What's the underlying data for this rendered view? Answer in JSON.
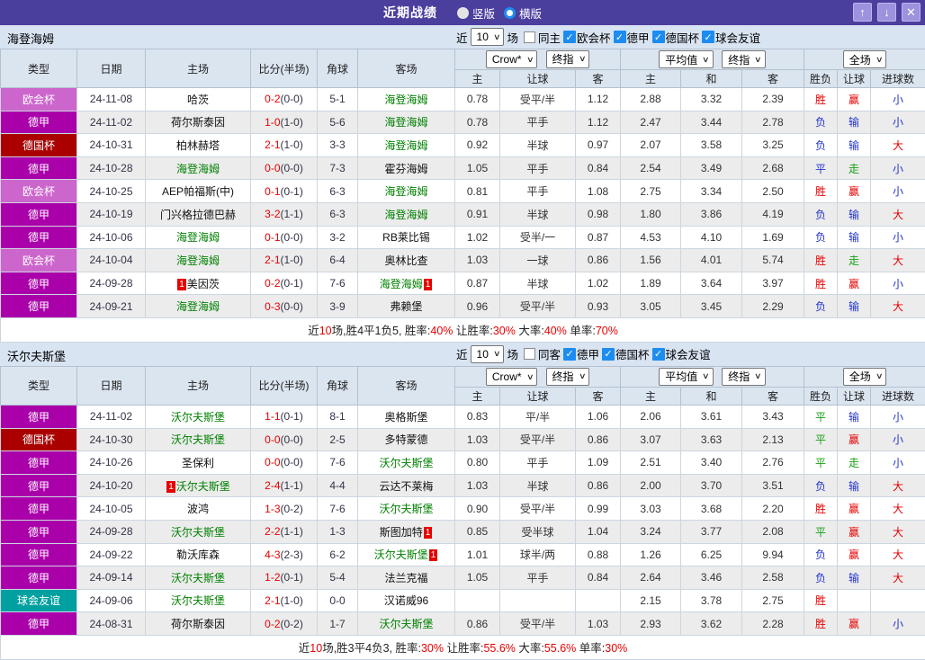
{
  "titlebar": {
    "title": "近期战绩",
    "vertical_label": "竖版",
    "horizontal_label": "横版",
    "up_glyph": "↑",
    "down_glyph": "↓",
    "close_glyph": "✕"
  },
  "colors": {
    "titlebar_bg": "#4b3f9e",
    "checkbox_blue": "#1d8cf0",
    "red": "#e60000",
    "blue": "#2233cc",
    "green": "#15a015",
    "team_green": "#008000",
    "league": {
      "欧会杯": "#cc66cc",
      "德甲": "#aa00aa",
      "德国杯": "#aa0000",
      "球会友谊": "#00a0a0"
    }
  },
  "table_header": {
    "cols": [
      "类型",
      "日期",
      "主场",
      "比分(半场)",
      "角球",
      "客场"
    ],
    "odds_source": "Crow*",
    "odds_final": "终指",
    "avg_source": "平均值",
    "avg_final": "终指",
    "scope": "全场",
    "sub": [
      "主",
      "让球",
      "客",
      "主",
      "和",
      "客",
      "胜负",
      "让球",
      "进球数"
    ]
  },
  "sections": [
    {
      "team": "海登海姆",
      "filter": {
        "near": "近",
        "count": "10",
        "games": "场",
        "same_label": "同主",
        "leagues": [
          "欧会杯",
          "德甲",
          "德国杯",
          "球会友谊"
        ]
      },
      "rows": [
        {
          "lg": "欧会杯",
          "date": "24-11-08",
          "home": "哈茨",
          "hg": false,
          "h1": false,
          "score": "0-2",
          "half": "(0-0)",
          "corner": "5-1",
          "away": "海登海姆",
          "ag": true,
          "a1": false,
          "odds": [
            "0.78",
            "受平/半",
            "1.12"
          ],
          "avg": [
            "2.88",
            "3.32",
            "2.39"
          ],
          "res": [
            [
              "胜",
              "r"
            ],
            [
              "赢",
              "r"
            ],
            [
              "小",
              "b"
            ]
          ]
        },
        {
          "lg": "德甲",
          "date": "24-11-02",
          "home": "荷尔斯泰因",
          "hg": false,
          "h1": false,
          "score": "1-0",
          "half": "(1-0)",
          "corner": "5-6",
          "away": "海登海姆",
          "ag": true,
          "a1": false,
          "odds": [
            "0.78",
            "平手",
            "1.12"
          ],
          "avg": [
            "2.47",
            "3.44",
            "2.78"
          ],
          "res": [
            [
              "负",
              "b"
            ],
            [
              "输",
              "b"
            ],
            [
              "小",
              "b"
            ]
          ]
        },
        {
          "lg": "德国杯",
          "date": "24-10-31",
          "home": "柏林赫塔",
          "hg": false,
          "h1": false,
          "score": "2-1",
          "half": "(1-0)",
          "corner": "3-3",
          "away": "海登海姆",
          "ag": true,
          "a1": false,
          "odds": [
            "0.92",
            "半球",
            "0.97"
          ],
          "avg": [
            "2.07",
            "3.58",
            "3.25"
          ],
          "res": [
            [
              "负",
              "b"
            ],
            [
              "输",
              "b"
            ],
            [
              "大",
              "r"
            ]
          ]
        },
        {
          "lg": "德甲",
          "date": "24-10-28",
          "home": "海登海姆",
          "hg": true,
          "h1": false,
          "score": "0-0",
          "half": "(0-0)",
          "corner": "7-3",
          "away": "霍芬海姆",
          "ag": false,
          "a1": false,
          "odds": [
            "1.05",
            "平手",
            "0.84"
          ],
          "avg": [
            "2.54",
            "3.49",
            "2.68"
          ],
          "res": [
            [
              "平",
              "b"
            ],
            [
              "走",
              "g"
            ],
            [
              "小",
              "b"
            ]
          ]
        },
        {
          "lg": "欧会杯",
          "date": "24-10-25",
          "home": "AEP帕福斯(中)",
          "hg": false,
          "h1": false,
          "score": "0-1",
          "half": "(0-1)",
          "corner": "6-3",
          "away": "海登海姆",
          "ag": true,
          "a1": false,
          "odds": [
            "0.81",
            "平手",
            "1.08"
          ],
          "avg": [
            "2.75",
            "3.34",
            "2.50"
          ],
          "res": [
            [
              "胜",
              "r"
            ],
            [
              "赢",
              "r"
            ],
            [
              "小",
              "b"
            ]
          ]
        },
        {
          "lg": "德甲",
          "date": "24-10-19",
          "home": "门兴格拉德巴赫",
          "hg": false,
          "h1": false,
          "score": "3-2",
          "half": "(1-1)",
          "corner": "6-3",
          "away": "海登海姆",
          "ag": true,
          "a1": false,
          "odds": [
            "0.91",
            "半球",
            "0.98"
          ],
          "avg": [
            "1.80",
            "3.86",
            "4.19"
          ],
          "res": [
            [
              "负",
              "b"
            ],
            [
              "输",
              "b"
            ],
            [
              "大",
              "r"
            ]
          ]
        },
        {
          "lg": "德甲",
          "date": "24-10-06",
          "home": "海登海姆",
          "hg": true,
          "h1": false,
          "score": "0-1",
          "half": "(0-0)",
          "corner": "3-2",
          "away": "RB莱比锡",
          "ag": false,
          "a1": false,
          "odds": [
            "1.02",
            "受半/一",
            "0.87"
          ],
          "avg": [
            "4.53",
            "4.10",
            "1.69"
          ],
          "res": [
            [
              "负",
              "b"
            ],
            [
              "输",
              "b"
            ],
            [
              "小",
              "b"
            ]
          ]
        },
        {
          "lg": "欧会杯",
          "date": "24-10-04",
          "home": "海登海姆",
          "hg": true,
          "h1": false,
          "score": "2-1",
          "half": "(1-0)",
          "corner": "6-4",
          "away": "奥林比查",
          "ag": false,
          "a1": false,
          "odds": [
            "1.03",
            "一球",
            "0.86"
          ],
          "avg": [
            "1.56",
            "4.01",
            "5.74"
          ],
          "res": [
            [
              "胜",
              "r"
            ],
            [
              "走",
              "g"
            ],
            [
              "大",
              "r"
            ]
          ]
        },
        {
          "lg": "德甲",
          "date": "24-09-28",
          "home": "美因茨",
          "hg": false,
          "h1": true,
          "score": "0-2",
          "half": "(0-1)",
          "corner": "7-6",
          "away": "海登海姆",
          "ag": true,
          "a1": true,
          "odds": [
            "0.87",
            "半球",
            "1.02"
          ],
          "avg": [
            "1.89",
            "3.64",
            "3.97"
          ],
          "res": [
            [
              "胜",
              "r"
            ],
            [
              "赢",
              "r"
            ],
            [
              "小",
              "b"
            ]
          ]
        },
        {
          "lg": "德甲",
          "date": "24-09-21",
          "home": "海登海姆",
          "hg": true,
          "h1": false,
          "score": "0-3",
          "half": "(0-0)",
          "corner": "3-9",
          "away": "弗赖堡",
          "ag": false,
          "a1": false,
          "odds": [
            "0.96",
            "受平/半",
            "0.93"
          ],
          "avg": [
            "3.05",
            "3.45",
            "2.29"
          ],
          "res": [
            [
              "负",
              "b"
            ],
            [
              "输",
              "b"
            ],
            [
              "大",
              "r"
            ]
          ]
        }
      ],
      "summary": [
        {
          "t": "近",
          "c": "k"
        },
        {
          "t": "10",
          "c": "r"
        },
        {
          "t": "场,胜4平1负5, 胜率:",
          "c": "k"
        },
        {
          "t": "40%",
          "c": "r"
        },
        {
          "t": " 让胜率:",
          "c": "k"
        },
        {
          "t": "30%",
          "c": "r"
        },
        {
          "t": " 大率:",
          "c": "k"
        },
        {
          "t": "40%",
          "c": "r"
        },
        {
          "t": " 单率:",
          "c": "k"
        },
        {
          "t": "70%",
          "c": "r"
        }
      ]
    },
    {
      "team": "沃尔夫斯堡",
      "filter": {
        "near": "近",
        "count": "10",
        "games": "场",
        "same_label": "同客",
        "leagues": [
          "德甲",
          "德国杯",
          "球会友谊"
        ]
      },
      "rows": [
        {
          "lg": "德甲",
          "date": "24-11-02",
          "home": "沃尔夫斯堡",
          "hg": true,
          "h1": false,
          "score": "1-1",
          "half": "(0-1)",
          "corner": "8-1",
          "away": "奥格斯堡",
          "ag": false,
          "a1": false,
          "odds": [
            "0.83",
            "平/半",
            "1.06"
          ],
          "avg": [
            "2.06",
            "3.61",
            "3.43"
          ],
          "res": [
            [
              "平",
              "g"
            ],
            [
              "输",
              "b"
            ],
            [
              "小",
              "b"
            ]
          ]
        },
        {
          "lg": "德国杯",
          "date": "24-10-30",
          "home": "沃尔夫斯堡",
          "hg": true,
          "h1": false,
          "score": "0-0",
          "half": "(0-0)",
          "corner": "2-5",
          "away": "多特蒙德",
          "ag": false,
          "a1": false,
          "odds": [
            "1.03",
            "受平/半",
            "0.86"
          ],
          "avg": [
            "3.07",
            "3.63",
            "2.13"
          ],
          "res": [
            [
              "平",
              "g"
            ],
            [
              "赢",
              "r"
            ],
            [
              "小",
              "b"
            ]
          ]
        },
        {
          "lg": "德甲",
          "date": "24-10-26",
          "home": "圣保利",
          "hg": false,
          "h1": false,
          "score": "0-0",
          "half": "(0-0)",
          "corner": "7-6",
          "away": "沃尔夫斯堡",
          "ag": true,
          "a1": false,
          "odds": [
            "0.80",
            "平手",
            "1.09"
          ],
          "avg": [
            "2.51",
            "3.40",
            "2.76"
          ],
          "res": [
            [
              "平",
              "g"
            ],
            [
              "走",
              "g"
            ],
            [
              "小",
              "b"
            ]
          ]
        },
        {
          "lg": "德甲",
          "date": "24-10-20",
          "home": "沃尔夫斯堡",
          "hg": true,
          "h1": true,
          "score": "2-4",
          "half": "(1-1)",
          "corner": "4-4",
          "away": "云达不莱梅",
          "ag": false,
          "a1": false,
          "odds": [
            "1.03",
            "半球",
            "0.86"
          ],
          "avg": [
            "2.00",
            "3.70",
            "3.51"
          ],
          "res": [
            [
              "负",
              "b"
            ],
            [
              "输",
              "b"
            ],
            [
              "大",
              "r"
            ]
          ]
        },
        {
          "lg": "德甲",
          "date": "24-10-05",
          "home": "波鸿",
          "hg": false,
          "h1": false,
          "score": "1-3",
          "half": "(0-2)",
          "corner": "7-6",
          "away": "沃尔夫斯堡",
          "ag": true,
          "a1": false,
          "odds": [
            "0.90",
            "受平/半",
            "0.99"
          ],
          "avg": [
            "3.03",
            "3.68",
            "2.20"
          ],
          "res": [
            [
              "胜",
              "r"
            ],
            [
              "赢",
              "r"
            ],
            [
              "大",
              "r"
            ]
          ]
        },
        {
          "lg": "德甲",
          "date": "24-09-28",
          "home": "沃尔夫斯堡",
          "hg": true,
          "h1": false,
          "score": "2-2",
          "half": "(1-1)",
          "corner": "1-3",
          "away": "斯图加特",
          "ag": false,
          "a1": true,
          "odds": [
            "0.85",
            "受半球",
            "1.04"
          ],
          "avg": [
            "3.24",
            "3.77",
            "2.08"
          ],
          "res": [
            [
              "平",
              "g"
            ],
            [
              "赢",
              "r"
            ],
            [
              "大",
              "r"
            ]
          ]
        },
        {
          "lg": "德甲",
          "date": "24-09-22",
          "home": "勒沃库森",
          "hg": false,
          "h1": false,
          "score": "4-3",
          "half": "(2-3)",
          "corner": "6-2",
          "away": "沃尔夫斯堡",
          "ag": true,
          "a1": true,
          "odds": [
            "1.01",
            "球半/两",
            "0.88"
          ],
          "avg": [
            "1.26",
            "6.25",
            "9.94"
          ],
          "res": [
            [
              "负",
              "b"
            ],
            [
              "赢",
              "r"
            ],
            [
              "大",
              "r"
            ]
          ]
        },
        {
          "lg": "德甲",
          "date": "24-09-14",
          "home": "沃尔夫斯堡",
          "hg": true,
          "h1": false,
          "score": "1-2",
          "half": "(0-1)",
          "corner": "5-4",
          "away": "法兰克福",
          "ag": false,
          "a1": false,
          "odds": [
            "1.05",
            "平手",
            "0.84"
          ],
          "avg": [
            "2.64",
            "3.46",
            "2.58"
          ],
          "res": [
            [
              "负",
              "b"
            ],
            [
              "输",
              "b"
            ],
            [
              "大",
              "r"
            ]
          ]
        },
        {
          "lg": "球会友谊",
          "date": "24-09-06",
          "home": "沃尔夫斯堡",
          "hg": true,
          "h1": false,
          "score": "2-1",
          "half": "(1-0)",
          "corner": "0-0",
          "away": "汉诺威96",
          "ag": false,
          "a1": false,
          "odds": [
            "",
            "",
            ""
          ],
          "avg": [
            "2.15",
            "3.78",
            "2.75"
          ],
          "res": [
            [
              "胜",
              "r"
            ],
            [
              "",
              ""
            ],
            [
              "",
              ""
            ]
          ]
        },
        {
          "lg": "德甲",
          "date": "24-08-31",
          "home": "荷尔斯泰因",
          "hg": false,
          "h1": false,
          "score": "0-2",
          "half": "(0-2)",
          "corner": "1-7",
          "away": "沃尔夫斯堡",
          "ag": true,
          "a1": false,
          "odds": [
            "0.86",
            "受平/半",
            "1.03"
          ],
          "avg": [
            "2.93",
            "3.62",
            "2.28"
          ],
          "res": [
            [
              "胜",
              "r"
            ],
            [
              "赢",
              "r"
            ],
            [
              "小",
              "b"
            ]
          ]
        }
      ],
      "summary": [
        {
          "t": "近",
          "c": "k"
        },
        {
          "t": "10",
          "c": "r"
        },
        {
          "t": "场,胜3平4负3, 胜率:",
          "c": "k"
        },
        {
          "t": "30%",
          "c": "r"
        },
        {
          "t": " 让胜率:",
          "c": "k"
        },
        {
          "t": "55.6%",
          "c": "r"
        },
        {
          "t": " 大率:",
          "c": "k"
        },
        {
          "t": "55.6%",
          "c": "r"
        },
        {
          "t": " 单率:",
          "c": "k"
        },
        {
          "t": "30%",
          "c": "r"
        }
      ]
    }
  ]
}
